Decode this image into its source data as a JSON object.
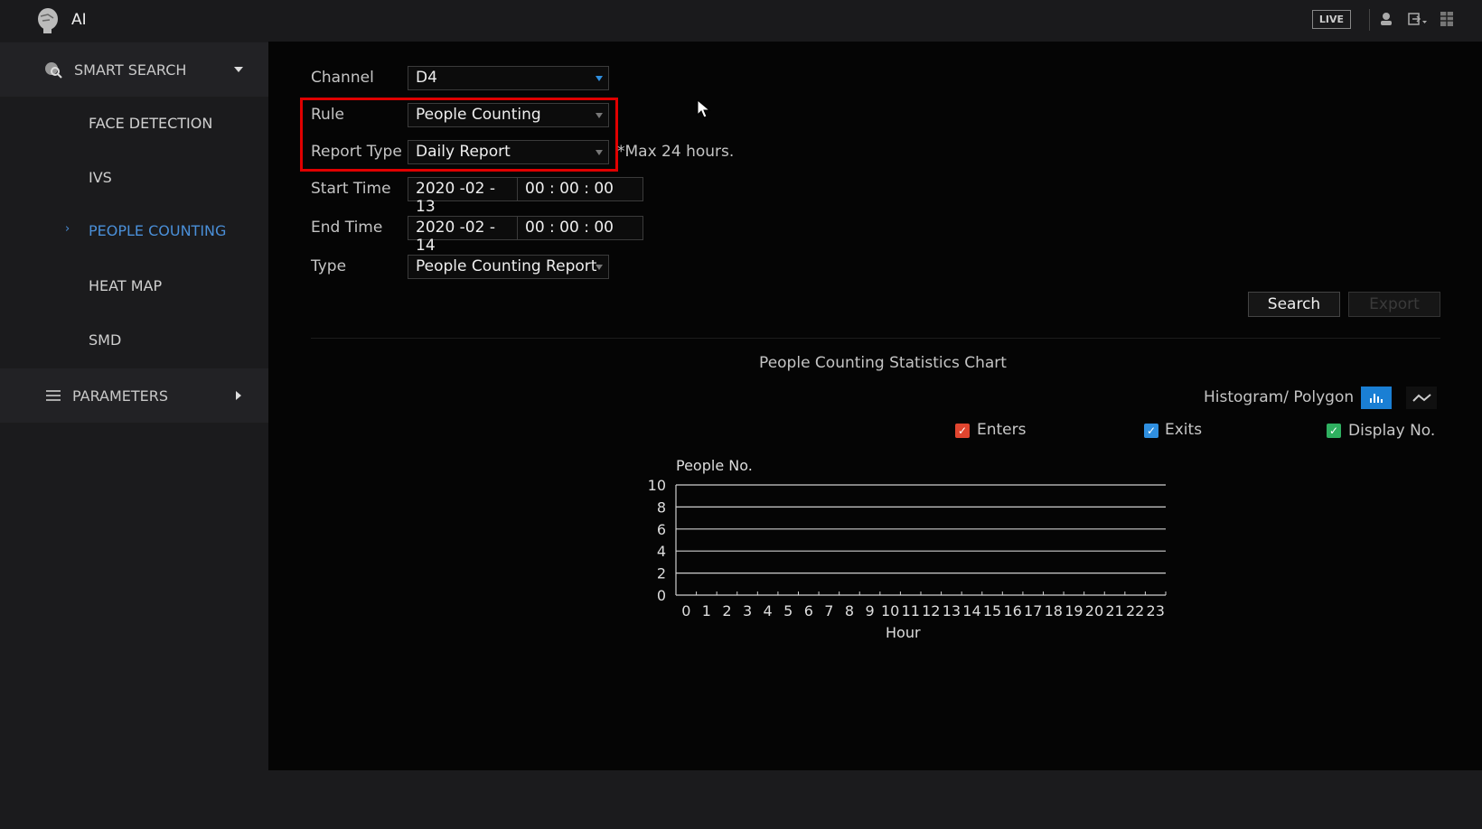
{
  "header": {
    "title": "AI",
    "live_label": "LIVE"
  },
  "sidebar": {
    "smart_search": "SMART SEARCH",
    "items": [
      {
        "label": "FACE DETECTION"
      },
      {
        "label": "IVS"
      },
      {
        "label": "PEOPLE COUNTING",
        "active": true
      },
      {
        "label": "HEAT MAP"
      },
      {
        "label": "SMD"
      }
    ],
    "parameters": "PARAMETERS"
  },
  "form": {
    "channel_label": "Channel",
    "channel_value": "D4",
    "rule_label": "Rule",
    "rule_value": "People Counting",
    "report_type_label": "Report Type",
    "report_type_value": "Daily Report",
    "max_note": "*Max 24 hours.",
    "start_label": "Start Time",
    "start_date": "2020 -02 - 13",
    "start_time": "00 : 00 : 00",
    "end_label": "End Time",
    "end_date": "2020 -02 - 14",
    "end_time": "00 : 00 : 00",
    "type_label": "Type",
    "type_value": "People Counting Report",
    "search_button": "Search",
    "export_button": "Export"
  },
  "chart_controls": {
    "mode_label": "Histogram/ Polygon",
    "legend": [
      {
        "label": "Enters",
        "color": "#e0452f"
      },
      {
        "label": "Exits",
        "color": "#2f8fe0"
      },
      {
        "label": "Display No.",
        "color": "#2fb060"
      }
    ]
  },
  "colors": {
    "accent": "#1a7fd4",
    "highlight_box": "#e00000",
    "active_item": "#4a8fd8"
  },
  "chart_data": {
    "type": "bar",
    "title": "People Counting Statistics Chart",
    "xlabel": "Hour",
    "ylabel": "People No.",
    "categories": [
      "0",
      "1",
      "2",
      "3",
      "4",
      "5",
      "6",
      "7",
      "8",
      "9",
      "10",
      "11",
      "12",
      "13",
      "14",
      "15",
      "16",
      "17",
      "18",
      "19",
      "20",
      "21",
      "22",
      "23"
    ],
    "yticks": [
      0,
      2,
      4,
      6,
      8,
      10
    ],
    "ylim": [
      0,
      10
    ],
    "series": [
      {
        "name": "Enters",
        "values": []
      },
      {
        "name": "Exits",
        "values": []
      }
    ],
    "grid": true
  }
}
